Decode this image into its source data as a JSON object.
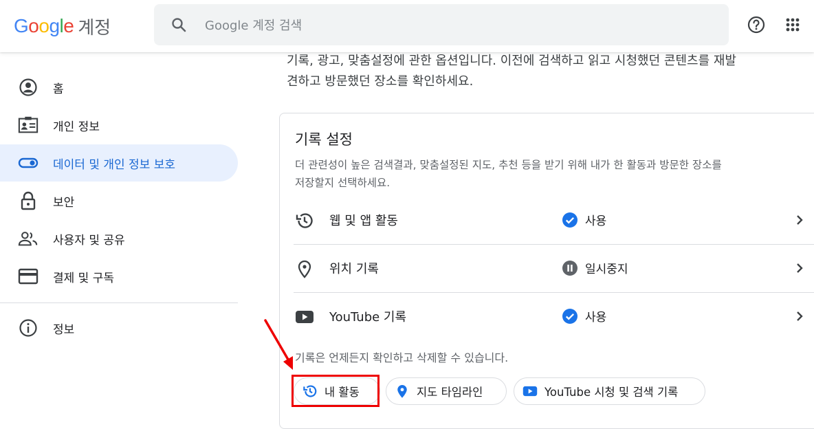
{
  "header": {
    "logo_letters": [
      "G",
      "o",
      "o",
      "g",
      "l",
      "e"
    ],
    "logo_colors": [
      "#4285f4",
      "#ea4335",
      "#fbbc05",
      "#4285f4",
      "#34a853",
      "#ea4335"
    ],
    "logo_suffix": "계정",
    "search_placeholder": "Google 계정 검색",
    "help_icon": "help-circle-icon",
    "apps_icon": "apps-grid-icon"
  },
  "sidebar": {
    "items": [
      {
        "label": "홈",
        "icon": "account-circle-icon",
        "active": false
      },
      {
        "label": "개인 정보",
        "icon": "id-card-icon",
        "active": false
      },
      {
        "label": "데이터 및 개인 정보 보호",
        "icon": "toggle-icon",
        "active": true
      },
      {
        "label": "보안",
        "icon": "lock-icon",
        "active": false
      },
      {
        "label": "사용자 및 공유",
        "icon": "people-icon",
        "active": false
      },
      {
        "label": "결제 및 구독",
        "icon": "credit-card-icon",
        "active": false
      }
    ],
    "footer_item": {
      "label": "정보",
      "icon": "info-icon"
    }
  },
  "main": {
    "intro_line1": "기록, 광고, 맞춤설정에 관한 옵션입니다. 이전에 검색하고 읽고 시청했던 콘텐츠를 재발",
    "intro_line2": "견하고 방문했던 장소를 확인하세요."
  },
  "card": {
    "title": "기록 설정",
    "desc_line1": "더 관련성이 높은 검색결과, 맞춤설정된 지도, 추천 등을 받기 위해 내가 한 활동과 방문한 장소를",
    "desc_line2": "저장할지 선택하세요.",
    "rows": [
      {
        "label": "웹 및 앱 활동",
        "icon": "history-icon",
        "status": "사용",
        "status_icon": "check-circle-icon"
      },
      {
        "label": "위치 기록",
        "icon": "location-pin-icon",
        "status": "일시중지",
        "status_icon": "pause-circle-icon"
      },
      {
        "label": "YouTube 기록",
        "icon": "youtube-icon",
        "status": "사용",
        "status_icon": "check-circle-icon"
      }
    ],
    "note": "기록은 언제든지 확인하고 삭제할 수 있습니다.",
    "chips": [
      {
        "label": "내 활동",
        "icon": "history-icon"
      },
      {
        "label": "지도 타임라인",
        "icon": "map-pin-icon"
      },
      {
        "label": "YouTube 시청 및 검색 기록",
        "icon": "youtube-icon"
      }
    ]
  },
  "colors": {
    "accent": "#1a73e8",
    "active_bg": "#e8f0fe",
    "highlight": "#ee0000"
  }
}
